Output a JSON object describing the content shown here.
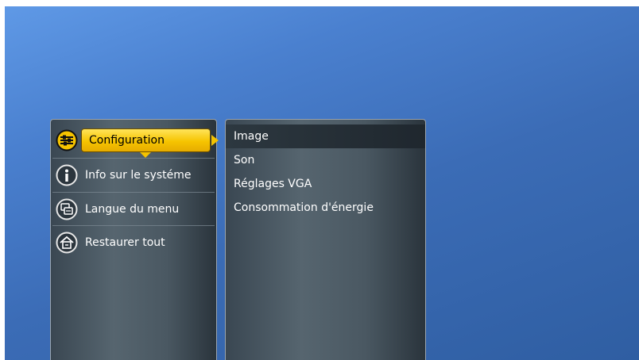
{
  "left_menu": {
    "items": [
      {
        "label": "Configuration",
        "icon": "settings-sliders-icon",
        "selected": true
      },
      {
        "label": "Info sur le systéme",
        "icon": "info-icon",
        "selected": false
      },
      {
        "label": "Langue du menu",
        "icon": "language-icon",
        "selected": false
      },
      {
        "label": "Restaurer tout",
        "icon": "home-restore-icon",
        "selected": false
      }
    ]
  },
  "submenu": {
    "items": [
      {
        "label": "Image",
        "highlighted": true
      },
      {
        "label": "Son",
        "highlighted": false
      },
      {
        "label": "Réglages VGA",
        "highlighted": false
      },
      {
        "label": "Consommation d'énergie",
        "highlighted": false
      }
    ]
  },
  "colors": {
    "accent": "#f6c400",
    "background": "#3b6cb6",
    "panel": "#4a5862"
  }
}
